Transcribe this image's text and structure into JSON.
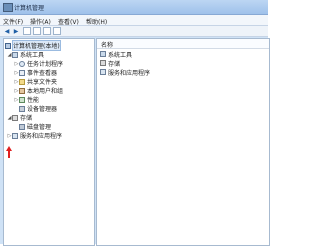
{
  "window": {
    "title": "计算机管理"
  },
  "menu": [
    "文件(F)",
    "操作(A)",
    "查看(V)",
    "帮助(H)"
  ],
  "tree": {
    "root": "计算机管理(本地)",
    "system_tools": "系统工具",
    "task_scheduler": "任务计划程序",
    "event_viewer": "事件查看器",
    "shared_folders": "共享文件夹",
    "local_users": "本地用户和组",
    "performance": "性能",
    "device_manager": "设备管理器",
    "storage": "存储",
    "disk_management": "磁盘管理",
    "services_apps": "服务和应用程序"
  },
  "list": {
    "header": "名称",
    "items": [
      "系统工具",
      "存储",
      "服务和应用程序"
    ]
  },
  "colors": {
    "title_bar": "#9fc1ea",
    "annotation_arrow": "#e02020"
  }
}
